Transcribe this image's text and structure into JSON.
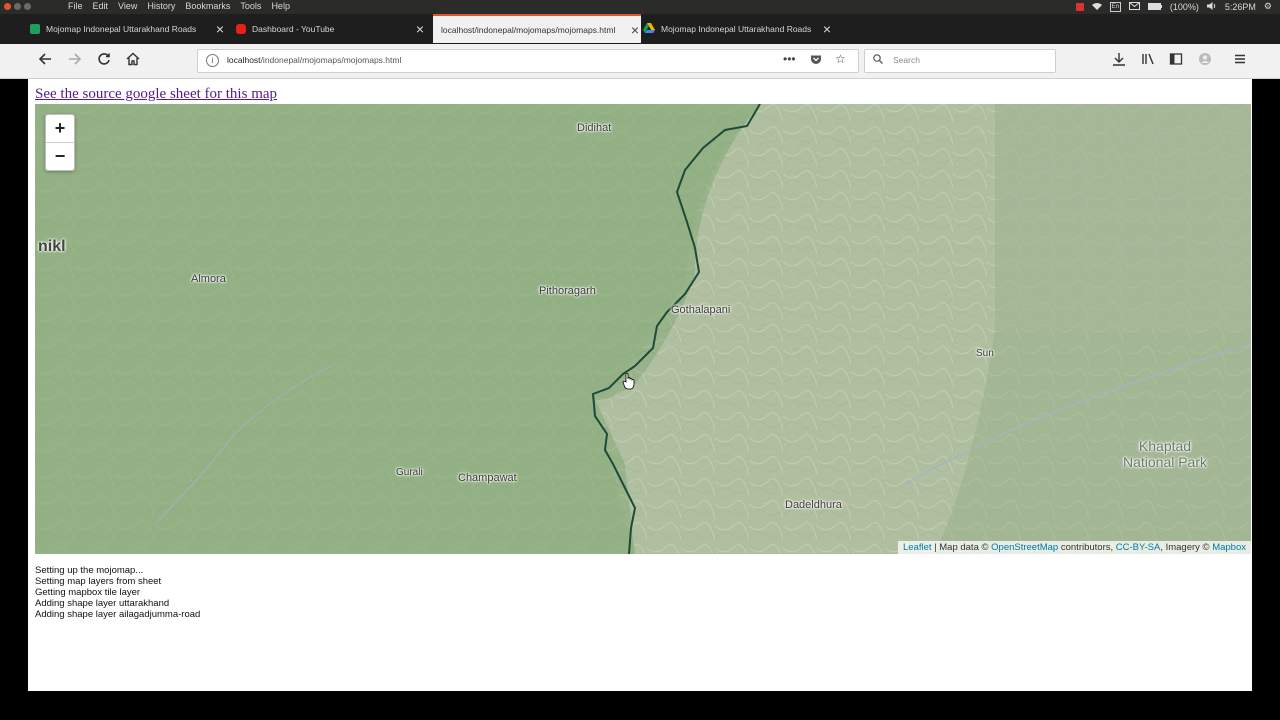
{
  "os_menubar": {
    "menus": [
      "File",
      "Edit",
      "View",
      "History",
      "Bookmarks",
      "Tools",
      "Help"
    ],
    "battery": "(100%)",
    "clock": "5:26PM"
  },
  "tabs": [
    {
      "title": "Mojomap Indonepal Uttarakhand Roads",
      "favicon_color": "#1e9e5a",
      "active": false
    },
    {
      "title": "Dashboard - YouTube",
      "favicon_color": "#e62117",
      "active": false
    },
    {
      "title": "localhost/indonepal/mojomaps/mojomaps.html",
      "favicon_color": "",
      "active": true
    },
    {
      "title": "Mojomap Indonepal Uttarakhand Roads",
      "favicon_color": "#f4b400",
      "active": false
    }
  ],
  "navbar": {
    "url_host": "localhost",
    "url_path": "/indonepal/mojomaps/mojomaps.html",
    "search_placeholder": "Search"
  },
  "page": {
    "source_link": "See the source google sheet for this map"
  },
  "map": {
    "zoom_in": "+",
    "zoom_out": "−",
    "labels": {
      "didihat": "Didihat",
      "nikl": "nikl",
      "almora": "Almora",
      "pithoragarh": "Pithoragarh",
      "gothalapani": "Gothalapani",
      "sun": "Sun",
      "khaptad": "Khaptad National Park",
      "gurali": "Gurali",
      "champawat": "Champawat",
      "dadeldhura": "Dadeldhura"
    },
    "attribution": {
      "leaflet": "Leaflet",
      "map_data": " | Map data © ",
      "osm": "OpenStreetMap",
      "contributors": " contributors, ",
      "ccbysa": "CC-BY-SA",
      "imagery": ", Imagery © ",
      "mapbox": "Mapbox"
    },
    "border_color": "#1e4a38"
  },
  "log_lines": [
    "Setting up the mojomap...",
    "Setting map layers from sheet",
    "Getting mapbox tile layer",
    "Adding shape layer uttarakhand",
    "Adding shape layer ailagadjumma-road"
  ]
}
